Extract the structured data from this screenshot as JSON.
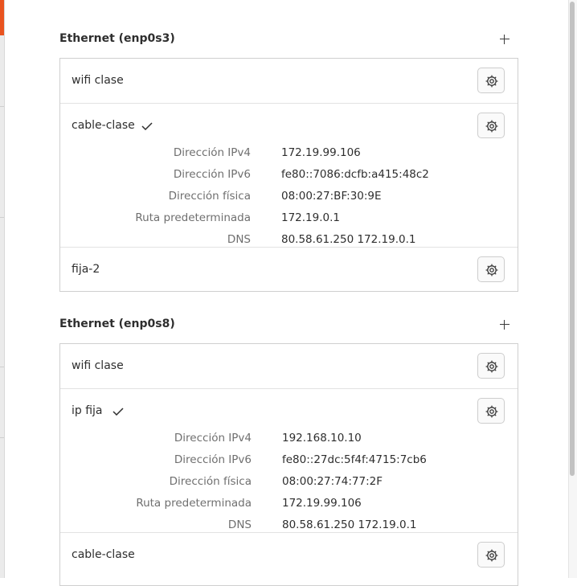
{
  "sections": [
    {
      "title": "Ethernet (enp0s3)",
      "connections": [
        {
          "name": "wifi clase",
          "active": false
        },
        {
          "name": "cable-clase",
          "active": true,
          "details": [
            {
              "label": "Dirección IPv4",
              "value": "172.19.99.106"
            },
            {
              "label": "Dirección IPv6",
              "value": "fe80::7086:dcfb:a415:48c2"
            },
            {
              "label": "Dirección física",
              "value": "08:00:27:BF:30:9E"
            },
            {
              "label": "Ruta predeterminada",
              "value": "172.19.0.1"
            },
            {
              "label": "DNS",
              "value": "80.58.61.250 172.19.0.1"
            }
          ]
        },
        {
          "name": "fija-2",
          "active": false
        }
      ]
    },
    {
      "title": "Ethernet (enp0s8)",
      "connections": [
        {
          "name": "wifi clase",
          "active": false
        },
        {
          "name": "ip fija",
          "active": true,
          "details": [
            {
              "label": "Dirección IPv4",
              "value": "192.168.10.10"
            },
            {
              "label": "Dirección IPv6",
              "value": "fe80::27dc:5f4f:4715:7cb6"
            },
            {
              "label": "Dirección física",
              "value": "08:00:27:74:77:2F"
            },
            {
              "label": "Ruta predeterminada",
              "value": "172.19.99.106"
            },
            {
              "label": "DNS",
              "value": "80.58.61.250 172.19.0.1"
            }
          ]
        },
        {
          "name": "cable-clase",
          "active": false
        }
      ]
    }
  ],
  "icons": {
    "add": "plus-icon",
    "settings": "gear-icon",
    "active": "check-icon"
  },
  "colors": {
    "accent": "#e9531f",
    "border": "#cfcfcf",
    "label": "#6f6f6f"
  }
}
